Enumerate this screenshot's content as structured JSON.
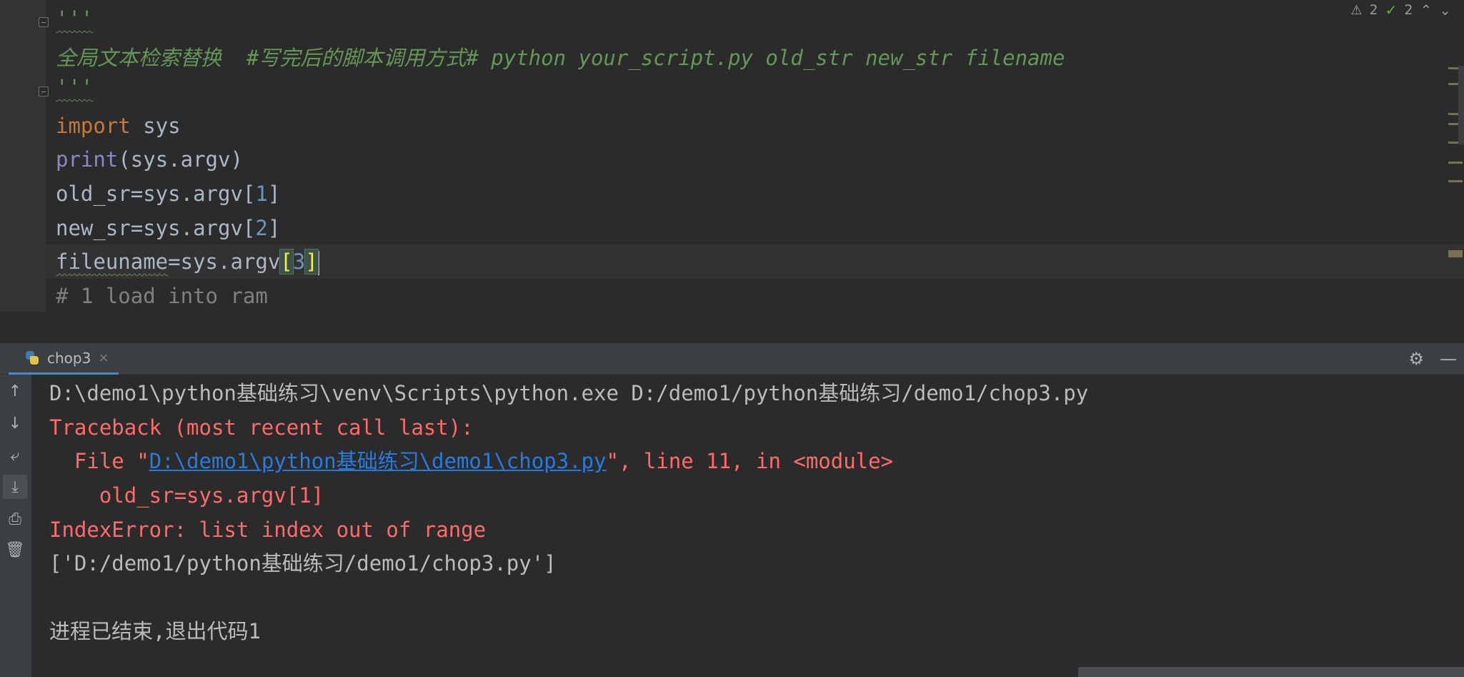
{
  "editor": {
    "inspections": {
      "warnings": "2",
      "weak_warnings": "2",
      "warn_icon": "warning-triangle-icon",
      "check_icon": "checkmark-icon"
    },
    "docstring_open": "'''",
    "docstring_text": "全局文本检索替换  #写完后的脚本调用方式# python your_script.py old_str new_str filename",
    "docstring_close": "'''",
    "lines": {
      "l1_kw": "import",
      "l1_rest": " sys",
      "l2_fn": "print",
      "l2_rest": "(sys.argv)",
      "l3_var": "old_sr",
      "l3_mid": "=sys.argv[",
      "l3_num": "1",
      "l3_end": "]",
      "l4_var": "new_sr",
      "l4_mid": "=sys.argv[",
      "l4_num": "2",
      "l4_end": "]",
      "l5_var": "fileuname",
      "l5_mid": "=sys.argv",
      "l5_open": "[",
      "l5_num": "3",
      "l5_close": "]",
      "l6_comment": "# 1 load into ram"
    }
  },
  "run_panel": {
    "tab_label": "chop3",
    "tab_close": "×",
    "settings_icon": "gear-icon",
    "minimize_icon": "minimize-icon",
    "toolbar": [
      "up-arrow-icon",
      "down-arrow-icon",
      "soft-wrap-icon",
      "scroll-to-end-icon",
      "print-icon",
      "trash-icon"
    ],
    "console": {
      "cmd": "D:\\demo1\\python基础练习\\venv\\Scripts\\python.exe D:/demo1/python基础练习/demo1/chop3.py",
      "traceback": "Traceback (most recent call last):",
      "file_prefix": "  File \"",
      "file_link": "D:\\demo1\\python基础练习\\demo1\\chop3.py",
      "file_suffix": "\", line 11, in <module>",
      "src_line": "    old_sr=sys.argv[1]",
      "error": "IndexError: list index out of range",
      "argv_out": "['D:/demo1/python基础练习/demo1/chop3.py']",
      "exit": "进程已结束,退出代码1"
    }
  }
}
